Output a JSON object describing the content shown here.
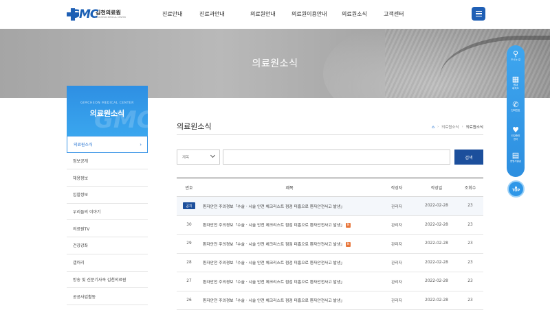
{
  "header": {
    "logo_letters": "GMC",
    "logo_name": "김천의료원",
    "logo_sub": "GIMCHEON MEDICAL CENTER",
    "nav": [
      "진료안내",
      "진료과안내",
      "의료원안내",
      "의료원이용안내",
      "의료원소식",
      "고객센터"
    ],
    "menu_icon": "hamburger-icon"
  },
  "banner": {
    "title": "의료원소식"
  },
  "sidebar": {
    "header_en": "GIMCHEON MEDICAL CENTER",
    "header_title": "의료원소식",
    "items": [
      {
        "label": "의료원소식",
        "active": true
      },
      {
        "label": "정보공개"
      },
      {
        "label": "채용정보"
      },
      {
        "label": "입찰정보"
      },
      {
        "label": "우리들의 이야기"
      },
      {
        "label": "의료원TV"
      },
      {
        "label": "건강강좌"
      },
      {
        "label": "갤러리"
      },
      {
        "label": "방송 및 신문기사속 김천의료원"
      },
      {
        "label": "공공사업활동"
      }
    ]
  },
  "content": {
    "title": "의료원소식",
    "breadcrumb": [
      "의료원소식",
      "의료원소식"
    ],
    "search": {
      "select_value": "제목",
      "input_value": "",
      "button_label": "검색"
    },
    "board": {
      "columns": [
        "번호",
        "제목",
        "작성자",
        "작성일",
        "조회수"
      ],
      "notice_badge": "공지",
      "new_badge": "N",
      "rows": [
        {
          "no": "공지",
          "title": "환자안전 주의경보「수술 · 시술 안전 체크리스트 점검 미흡으로 환자안전사고 발생」",
          "author": "관리자",
          "date": "2022-02-28",
          "views": "23",
          "notice": true,
          "new": false
        },
        {
          "no": "30",
          "title": "환자안전 주의경보「수술 · 시술 안전 체크리스트 점검 미흡으로 환자안전사고 발생」",
          "author": "관리자",
          "date": "2022-02-28",
          "views": "23",
          "notice": false,
          "new": true
        },
        {
          "no": "29",
          "title": "환자안전 주의경보「수술 · 시술 안전 체크리스트 점검 미흡으로 환자안전사고 발생」",
          "author": "관리자",
          "date": "2022-02-28",
          "views": "23",
          "notice": false,
          "new": true
        },
        {
          "no": "28",
          "title": "환자안전 주의경보「수술 · 시술 안전 체크리스트 점검 미흡으로 환자안전사고 발생」",
          "author": "관리자",
          "date": "2022-02-28",
          "views": "23",
          "notice": false,
          "new": false
        },
        {
          "no": "27",
          "title": "환자안전 주의경보「수술 · 시술 안전 체크리스트 점검 미흡으로 환자안전사고 발생」",
          "author": "관리자",
          "date": "2022-02-28",
          "views": "23",
          "notice": false,
          "new": false
        },
        {
          "no": "26",
          "title": "환자안전 주의경보「수술 · 시술 안전 체크리스트 점검 미흡으로 환자안전사고 발생」",
          "author": "관리자",
          "date": "2022-02-28",
          "views": "23",
          "notice": false,
          "new": false
        }
      ]
    }
  },
  "quickbar": {
    "items": [
      {
        "label": "오시는 길",
        "icon": "map-pin-icon"
      },
      {
        "label": "원내\n배치도",
        "icon": "building-icon"
      },
      {
        "label": "전화번호",
        "icon": "phone-icon"
      },
      {
        "label": "건강증진\n센터",
        "icon": "health-center-icon"
      },
      {
        "label": "증명서발급",
        "icon": "certificate-icon"
      }
    ],
    "top_label": "TOP"
  },
  "colors": {
    "primary": "#1c4f9c",
    "accent": "#2e8fe3",
    "new_badge": "#e8763a"
  }
}
